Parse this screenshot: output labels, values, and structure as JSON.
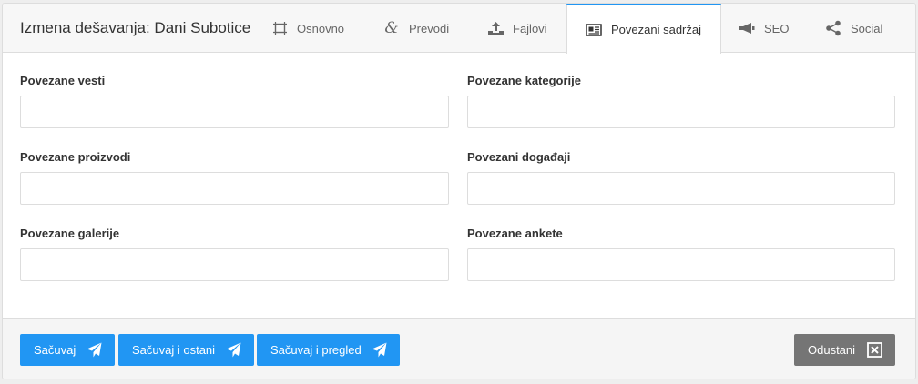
{
  "header": {
    "title": "Izmena dešavanja: Dani Subotice",
    "tabs": [
      {
        "label": "Osnovno",
        "icon": "frame-icon"
      },
      {
        "label": "Prevodi",
        "icon": "ampersand-icon"
      },
      {
        "label": "Fajlovi",
        "icon": "upload-icon"
      },
      {
        "label": "Povezani sadržaj",
        "icon": "newspaper-icon",
        "active": true
      },
      {
        "label": "SEO",
        "icon": "megaphone-icon"
      },
      {
        "label": "Social",
        "icon": "share-icon"
      }
    ]
  },
  "form": {
    "fields": [
      {
        "label": "Povezane vesti",
        "value": ""
      },
      {
        "label": "Povezane kategorije",
        "value": ""
      },
      {
        "label": "Povezane proizvodi",
        "value": ""
      },
      {
        "label": "Povezani događaji",
        "value": ""
      },
      {
        "label": "Povezane galerije",
        "value": ""
      },
      {
        "label": "Povezane ankete",
        "value": ""
      }
    ]
  },
  "footer": {
    "save": "Sačuvaj",
    "save_stay": "Sačuvaj i ostani",
    "save_preview": "Sačuvaj i pregled",
    "cancel": "Odustani"
  },
  "colors": {
    "accent": "#2196f3",
    "cancel": "#757575"
  }
}
